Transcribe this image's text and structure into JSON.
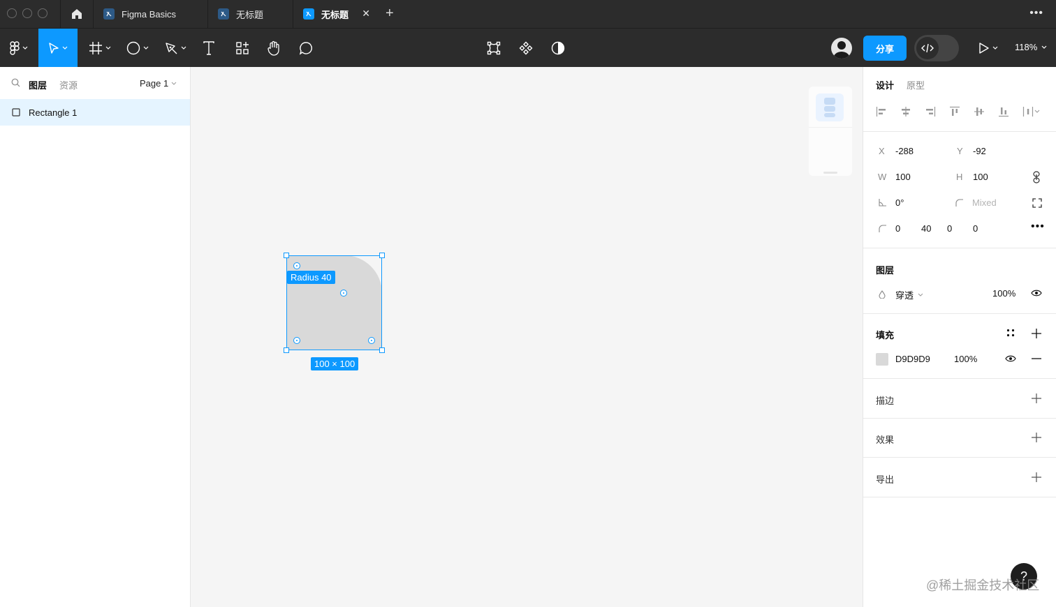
{
  "tabs": [
    {
      "label": "Figma Basics"
    },
    {
      "label": "无标题"
    },
    {
      "label": "无标题"
    }
  ],
  "toolbar": {
    "share_label": "分享",
    "zoom": "118%"
  },
  "left_panel": {
    "tab_layers": "图层",
    "tab_assets": "资源",
    "page": "Page 1",
    "layers": [
      {
        "name": "Rectangle 1"
      }
    ]
  },
  "canvas": {
    "radius_tooltip": "Radius 40",
    "size_tooltip": "100 × 100"
  },
  "right_panel": {
    "tab_design": "设计",
    "tab_prototype": "原型",
    "x_label": "X",
    "x": "-288",
    "y_label": "Y",
    "y": "-92",
    "w_label": "W",
    "w": "100",
    "h_label": "H",
    "h": "100",
    "rotation": "0°",
    "corner_mixed": "Mixed",
    "corners": [
      "0",
      "40",
      "0",
      "0"
    ],
    "layer_section": "图层",
    "blend_mode": "穿透",
    "layer_opacity": "100%",
    "fill_section": "填充",
    "fill_hex": "D9D9D9",
    "fill_opacity": "100%",
    "stroke_section": "描边",
    "effects_section": "效果",
    "export_section": "导出"
  },
  "watermark": "@稀土掘金技术社区",
  "help_label": "?",
  "colors": {
    "accent": "#0d99ff",
    "toolbar_bg": "#2c2c2c",
    "fill": "#d9d9d9"
  }
}
